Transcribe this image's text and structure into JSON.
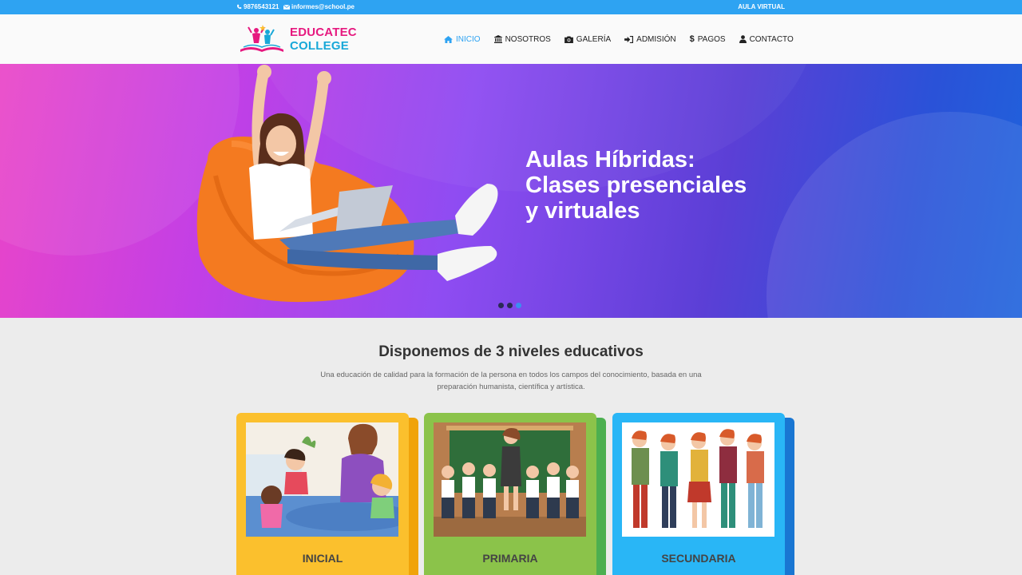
{
  "topbar": {
    "phone": "9876543121",
    "email": "informes@school.pe",
    "aula_link": "AULA VIRTUAL"
  },
  "logo": {
    "part1": "EDUCATEC",
    "part2": "COLLEGE"
  },
  "nav": {
    "items": [
      {
        "label": "INICIO",
        "icon": "home-icon",
        "active": true
      },
      {
        "label": "NOSOTROS",
        "icon": "institution-icon"
      },
      {
        "label": "GALERÍA",
        "icon": "camera-icon"
      },
      {
        "label": "ADMISIÓN",
        "icon": "sign-in-icon"
      },
      {
        "label": "PAGOS",
        "icon": "dollar-icon"
      },
      {
        "label": "CONTACTO",
        "icon": "user-icon"
      }
    ]
  },
  "hero": {
    "title_line1": "Aulas Híbridas:",
    "title_line2": "Clases presenciales",
    "title_line3": "y virtuales",
    "slides": 3,
    "active_slide": 3
  },
  "section": {
    "title": "Disponemos de 3 niveles educativos",
    "subtitle": "Una educación de calidad para la formación de la persona en todos los campos del conocimiento, basada en una preparación humanista, científica y artística."
  },
  "cards": [
    {
      "label": "INICIAL",
      "color": "#fbc02d",
      "shadow": "#f0a30a"
    },
    {
      "label": "PRIMARIA",
      "color": "#8bc34a",
      "shadow": "#4caf50"
    },
    {
      "label": "SECUNDARIA",
      "color": "#29b6f6",
      "shadow": "#1976d2"
    }
  ],
  "colors": {
    "accent": "#2ea3f2",
    "brand_pink": "#e6197f",
    "brand_blue": "#18a8d8"
  }
}
